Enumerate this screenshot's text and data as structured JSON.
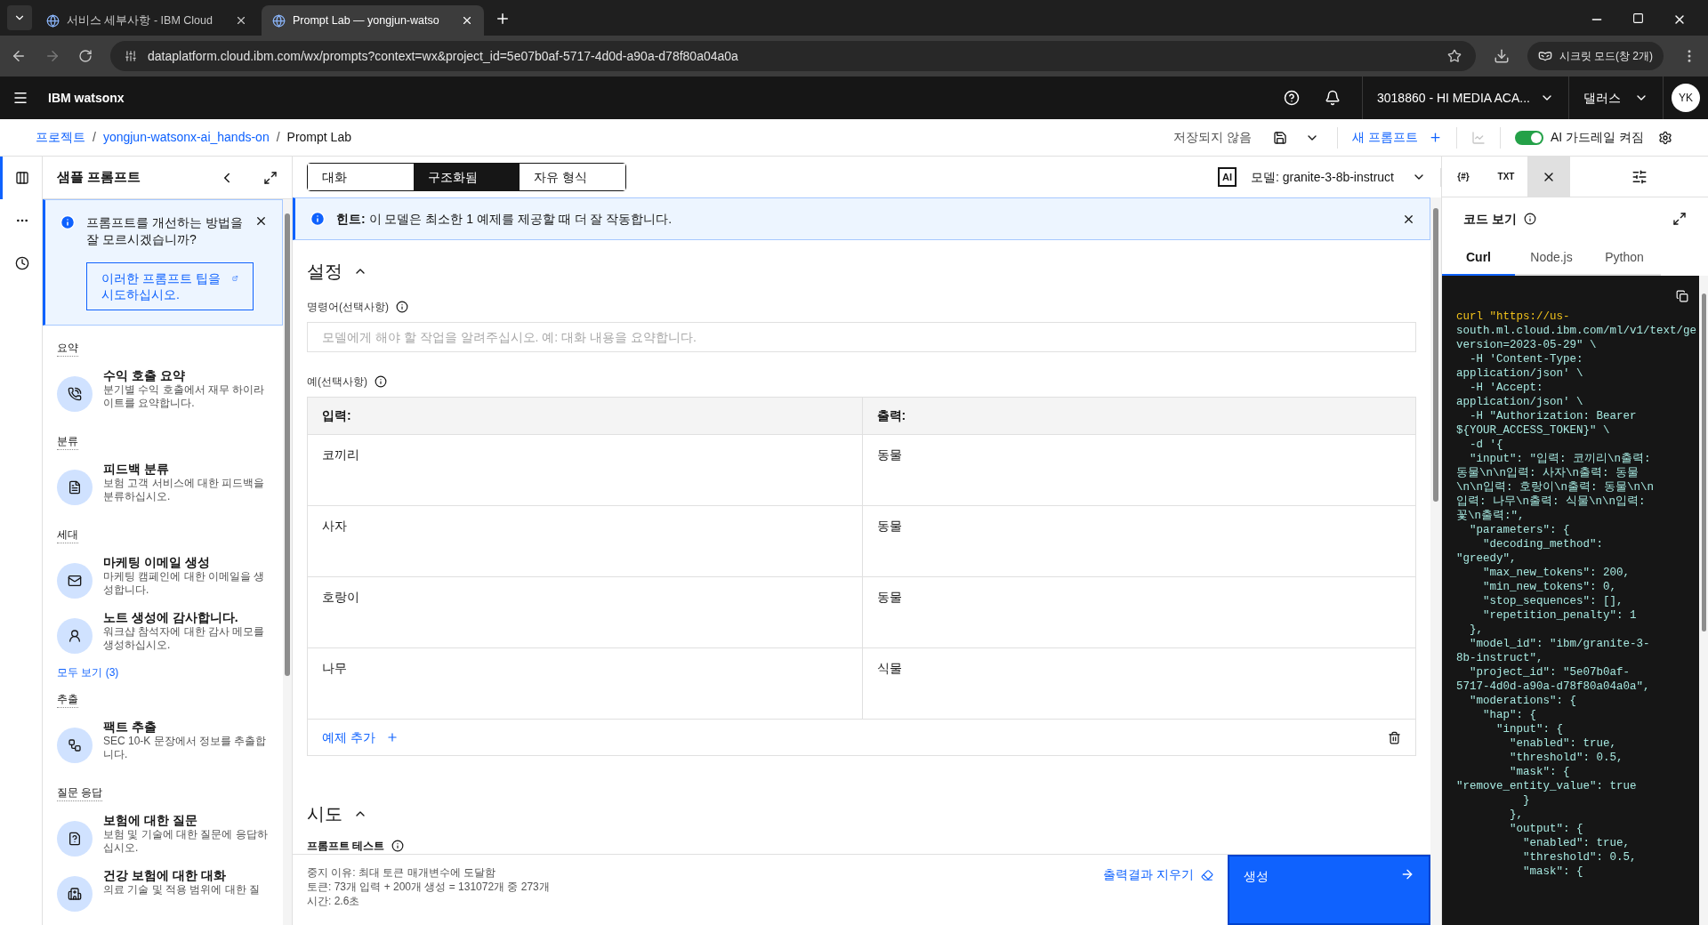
{
  "browser": {
    "tabs": [
      {
        "title": "서비스 세부사항 - IBM Cloud",
        "selected": false
      },
      {
        "title": "Prompt Lab — yongjun-watso",
        "selected": true
      }
    ],
    "url": "dataplatform.cloud.ibm.com/wx/prompts?context=wx&project_id=5e07b0af-5717-4d0d-a90a-d78f80a04a0a",
    "incognito": "시크릿 모드(창 2개)"
  },
  "header": {
    "product": "IBM watsonx",
    "account": "3018860 - HI MEDIA ACA...",
    "region": "댈러스",
    "avatar": "YK"
  },
  "breadcrumb": {
    "items": [
      "프로젝트",
      "yongjun-watsonx-ai_hands-on",
      "Prompt Lab"
    ],
    "separator": "/",
    "save_status": "저장되지 않음",
    "new_prompt": "새 프롬프트",
    "guardrail": {
      "label": "AI 가드레일 켜짐",
      "on": true
    }
  },
  "rail": [
    {
      "kind": "samples",
      "selected": true
    },
    {
      "kind": "variables",
      "selected": false
    },
    {
      "kind": "history",
      "selected": false
    }
  ],
  "samples": {
    "title": "샘플 프롬프트",
    "tip": {
      "text": "프롬프트를 개선하는 방법을 잘 모르시겠습니까?",
      "link": "이러한 프롬프트 팁을 시도하십시오."
    },
    "categories": [
      {
        "name": "요약",
        "items": [
          {
            "kind": "phone",
            "title": "수익 호출 요약",
            "desc": "분기별 수익 호출에서 재무 하이라이트를 요약합니다."
          }
        ]
      },
      {
        "name": "분류",
        "items": [
          {
            "kind": "document",
            "title": "피드백 분류",
            "desc": "보험 고객 서비스에 대한 피드백을 분류하십시오."
          }
        ]
      },
      {
        "name": "세대",
        "items": [
          {
            "kind": "mail",
            "title": "마케팅 이메일 생성",
            "desc": "마케팅 캠페인에 대한 이메일을 생성합니다."
          },
          {
            "kind": "person",
            "title": "노트 생성에 감사합니다.",
            "desc": "워크샵 참석자에 대한 감사 메모를 생성하십시오."
          }
        ],
        "see_all": "모두 보기 (3)"
      },
      {
        "name": "추출",
        "items": [
          {
            "kind": "network",
            "title": "팩트 추출",
            "desc": "SEC 10-K 문장에서 정보를 추출합니다."
          }
        ]
      },
      {
        "name": "질문 응답",
        "items": [
          {
            "kind": "question",
            "title": "보험에 대한 질문",
            "desc": "보험 및 기술에 대한 질문에 응답하십시오."
          },
          {
            "kind": "hospital",
            "title": "건강 보험에 대한 대화",
            "desc": "의료 기술 및 적용 범위에 대한 질"
          }
        ]
      }
    ]
  },
  "main": {
    "modes": [
      {
        "label": "대화",
        "selected": false
      },
      {
        "label": "구조화됨",
        "selected": true
      },
      {
        "label": "자유 형식",
        "selected": false
      }
    ],
    "model": {
      "badge": "AI",
      "label": "모델: granite-3-8b-instruct"
    },
    "tools": [
      "{#}",
      "TXT"
    ],
    "hint": "**힌트:** 이 모델은 최소한 1 예제를 제공할 때 더 잘 작동합니다.",
    "setup": {
      "title": "설정",
      "expanded": true,
      "instruction": {
        "label": "명령어(선택사항)",
        "placeholder": "모델에게 해야 할 작업을 알려주십시오. 예: 대화 내용을 요약합니다."
      },
      "examples": {
        "label": "예(선택사항)",
        "columns": [
          "입력:",
          "출력:"
        ],
        "rows": [
          [
            "코끼리",
            "동물"
          ],
          [
            "사자",
            "동물"
          ],
          [
            "호랑이",
            "동물"
          ],
          [
            "나무",
            "식물"
          ]
        ],
        "add": "예제 추가"
      }
    },
    "try": {
      "title": "시도",
      "expanded": true,
      "test_label": "프롬프트 테스트"
    },
    "footer": {
      "stats": [
        "중지 이유: 최대 토큰 매개변수에 도달함",
        "토큰: 73개 입력 + 200개 생성 = 131072개 중 273개",
        "시간: 2.6초"
      ],
      "clear": "출력결과 지우기",
      "generate": "생성"
    }
  },
  "code": {
    "title": "코드 보기",
    "tabs": [
      {
        "label": "Curl",
        "selected": true
      },
      {
        "label": "Node.js",
        "selected": false
      },
      {
        "label": "Python",
        "selected": false
      }
    ],
    "lines": [
      "curl \"https://us-",
      "south.ml.cloud.ibm.com/ml/v1/text/ge",
      "version=2023-05-29\" \\",
      "  -H 'Content-Type:",
      "application/json' \\",
      "  -H 'Accept:",
      "application/json' \\",
      "  -H \"Authorization: Bearer",
      "${YOUR_ACCESS_TOKEN}\" \\",
      "  -d '{",
      "  \"input\": \"입력: 코끼리\\n출력:",
      "동물\\n\\n입력: 사자\\n출력: 동물",
      "\\n\\n입력: 호랑이\\n출력: 동물\\n\\n",
      "입력: 나무\\n출력: 식물\\n\\n입력:",
      "꽃\\n출력:\",",
      "  \"parameters\": {",
      "    \"decoding_method\":",
      "\"greedy\",",
      "    \"max_new_tokens\": 200,",
      "    \"min_new_tokens\": 0,",
      "    \"stop_sequences\": [],",
      "    \"repetition_penalty\": 1",
      "  },",
      "  \"model_id\": \"ibm/granite-3-",
      "8b-instruct\",",
      "  \"project_id\": \"5e07b0af-",
      "5717-4d0d-a90a-d78f80a04a0a\",",
      "  \"moderations\": {",
      "    \"hap\": {",
      "      \"input\": {",
      "        \"enabled\": true,",
      "        \"threshold\": 0.5,",
      "        \"mask\": {",
      "\"remove_entity_value\": true",
      "          }",
      "        },",
      "        \"output\": {",
      "          \"enabled\": true,",
      "          \"threshold\": 0.5,",
      "          \"mask\": {"
    ]
  }
}
